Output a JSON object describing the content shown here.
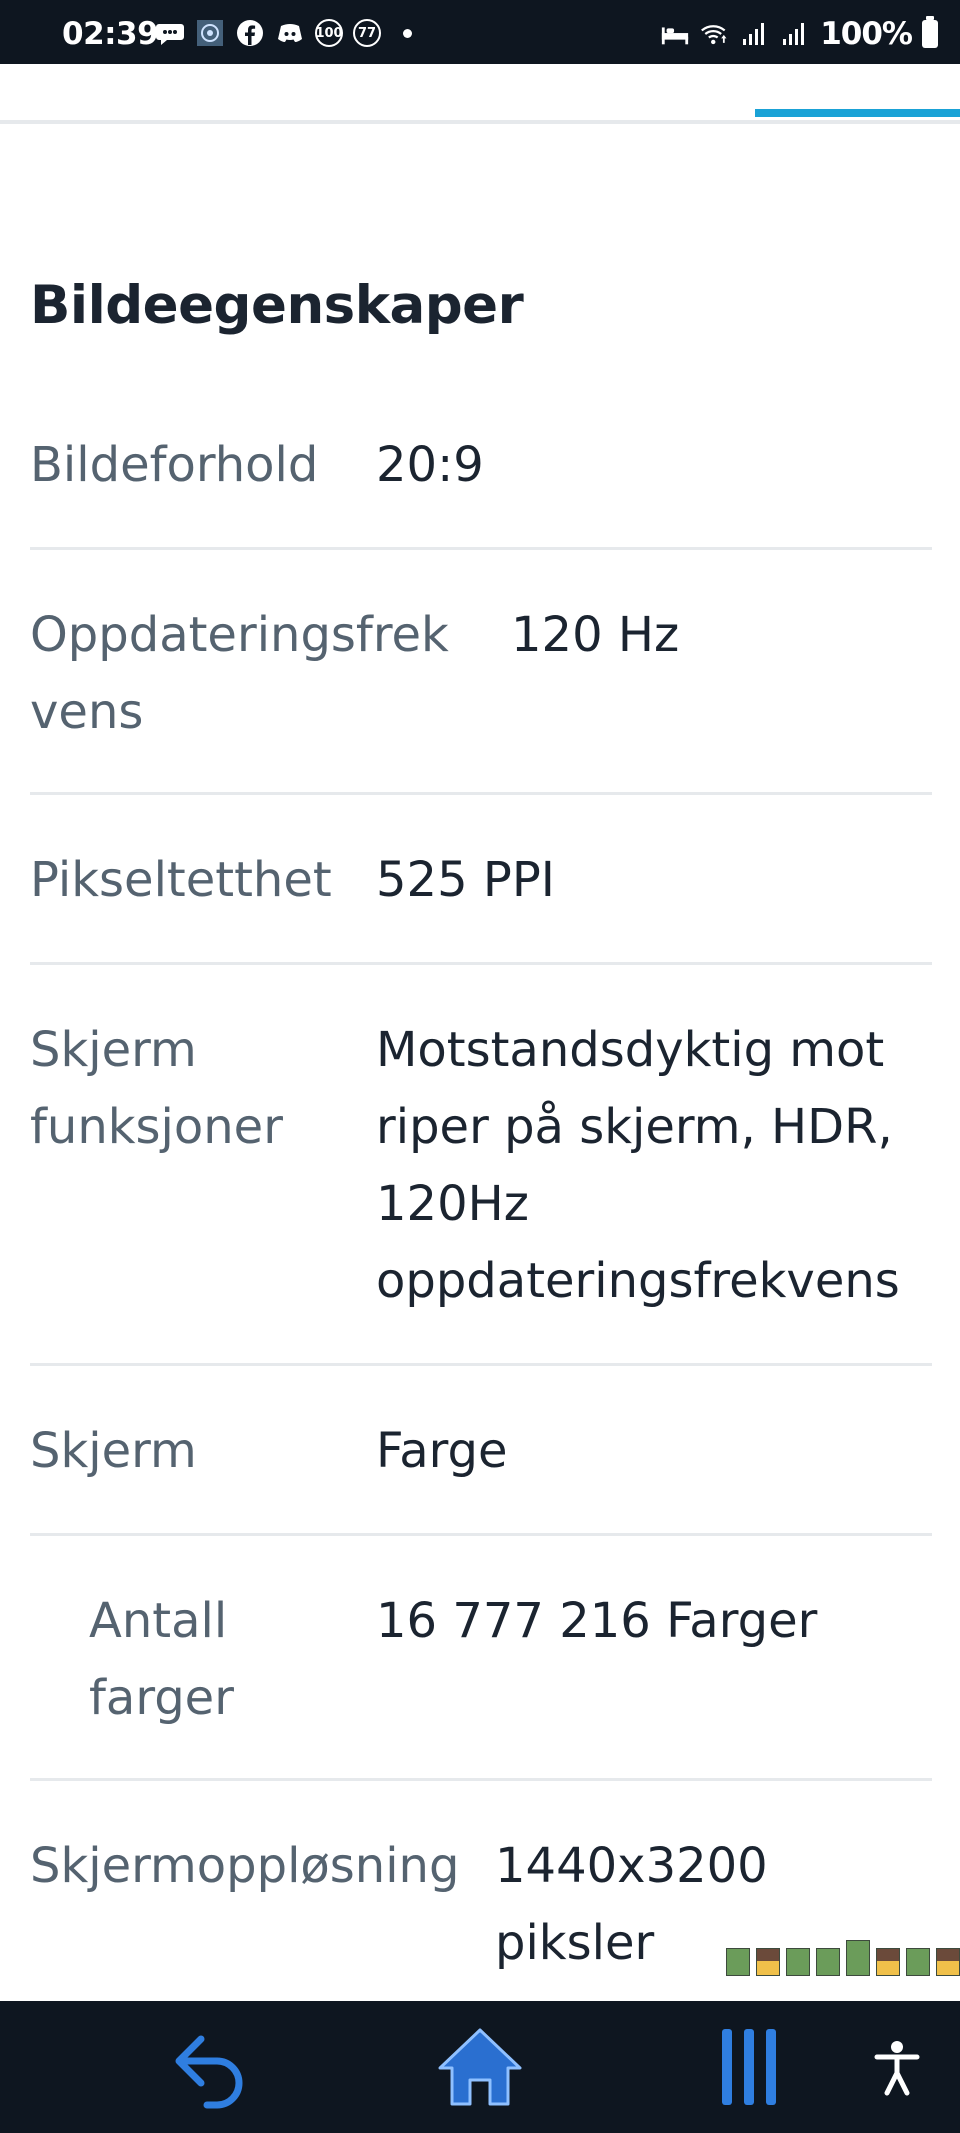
{
  "status_bar": {
    "time": "02:39",
    "badge_100": "100",
    "badge_77": "77",
    "battery_text": "100%"
  },
  "section": {
    "title": "Bildeegenskaper"
  },
  "specs": [
    {
      "label_lines": [
        "Bildeforhold"
      ],
      "value_lines": [
        "20:9"
      ]
    },
    {
      "label_lines": [
        "Oppdateringsfrek",
        "vens"
      ],
      "value_lines": [
        "120 Hz"
      ]
    },
    {
      "label_lines": [
        "Pikseltetthet"
      ],
      "value_lines": [
        "525 PPI"
      ]
    },
    {
      "label_lines": [
        "Skjerm",
        "funksjoner"
      ],
      "value_lines": [
        "Motstandsdyktig mot",
        "riper på skjerm, HDR,",
        "120Hz",
        "oppdateringsfrekvens"
      ]
    },
    {
      "label_lines": [
        "Skjerm"
      ],
      "value_lines": [
        "Farge"
      ]
    },
    {
      "label_lines": [
        "Antall",
        "farger"
      ],
      "value_lines": [
        "16 777 216 Farger"
      ]
    },
    {
      "label_lines": [
        "Skjermoppløsning"
      ],
      "value_lines": [
        "1440x3200",
        "piksler"
      ]
    }
  ],
  "nav": {
    "back_icon": "back-arrow-icon",
    "home_icon": "home-icon",
    "recents_icon": "recents-icon",
    "accessibility_icon": "accessibility-icon"
  },
  "colors": {
    "accent_tab": "#1aa2d6",
    "label": "#556370",
    "value": "#1b2430",
    "bars_dark": "#0e1620"
  }
}
